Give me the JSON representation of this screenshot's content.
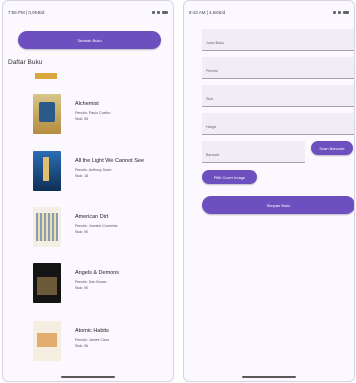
{
  "left_screen": {
    "status_time": "7:55 PM | 0,0KB/d",
    "add_button": "Tambah Buku",
    "list_title": "Daftar Buku",
    "books": [
      {
        "title": "Alchemist",
        "author": "Penulis: Paulo Coelho",
        "stock": "Stok: 55"
      },
      {
        "title": "All the Light We Cannot See",
        "author": "Penulis: Anthony Doerr",
        "stock": "Stok: 18"
      },
      {
        "title": "American Dirt",
        "author": "Penulis: Jeanine Cummins",
        "stock": "Stok: 90"
      },
      {
        "title": "Angels & Demons",
        "author": "Penulis: Dan Brown",
        "stock": "Stok: 90"
      },
      {
        "title": "Atomic Habits",
        "author": "Penulis: James Clear",
        "stock": "Stok: 56"
      }
    ]
  },
  "right_screen": {
    "status_time": "8:43 AM | 4,5KB/d",
    "fields": [
      "Judul Buku",
      "Penulis",
      "Stok",
      "Harga"
    ],
    "barcode_label": "Barcode",
    "scan_button": "Scan Barcode",
    "cover_button": "Pilih Cover Image",
    "save_button": "Simpan Buku"
  },
  "colors": {
    "accent": "#6d4fbf",
    "background": "#fbf8ff"
  }
}
